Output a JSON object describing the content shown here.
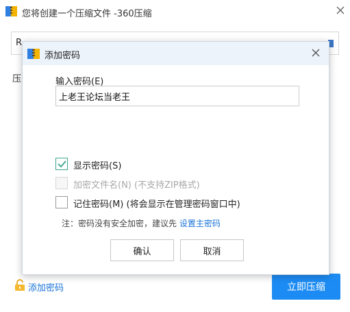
{
  "window": {
    "title": "您将创建一个压缩文件 -360压缩",
    "path_value": "R",
    "format_label": "压",
    "add_password_link": "添加密码",
    "compress_button": "立即压缩"
  },
  "dialog": {
    "title": "添加密码",
    "password_label": "输入密码(E)",
    "password_value": "上老王论坛当老王",
    "options": [
      {
        "label": "显示密码(S)",
        "checked": true,
        "disabled": false
      },
      {
        "label": "加密文件名(N) (不支持ZIP格式)",
        "checked": false,
        "disabled": true
      },
      {
        "label": "记住密码(M) (将会显示在管理密码窗口中)",
        "checked": false,
        "disabled": false
      }
    ],
    "note_prefix": "注：密码没有安全加密，建议先 ",
    "note_link": "设置主密码",
    "ok_button": "确认",
    "cancel_button": "取消"
  },
  "colors": {
    "accent_blue": "#1c8cf4",
    "link_blue": "#1a73d9",
    "check_green": "#3aa68c",
    "dialog_title_bg": "#edf3fb"
  },
  "icons": {
    "app": "360-zip-icon",
    "close": "close-icon",
    "lock": "lock-icon",
    "folder": "folder-icon"
  }
}
